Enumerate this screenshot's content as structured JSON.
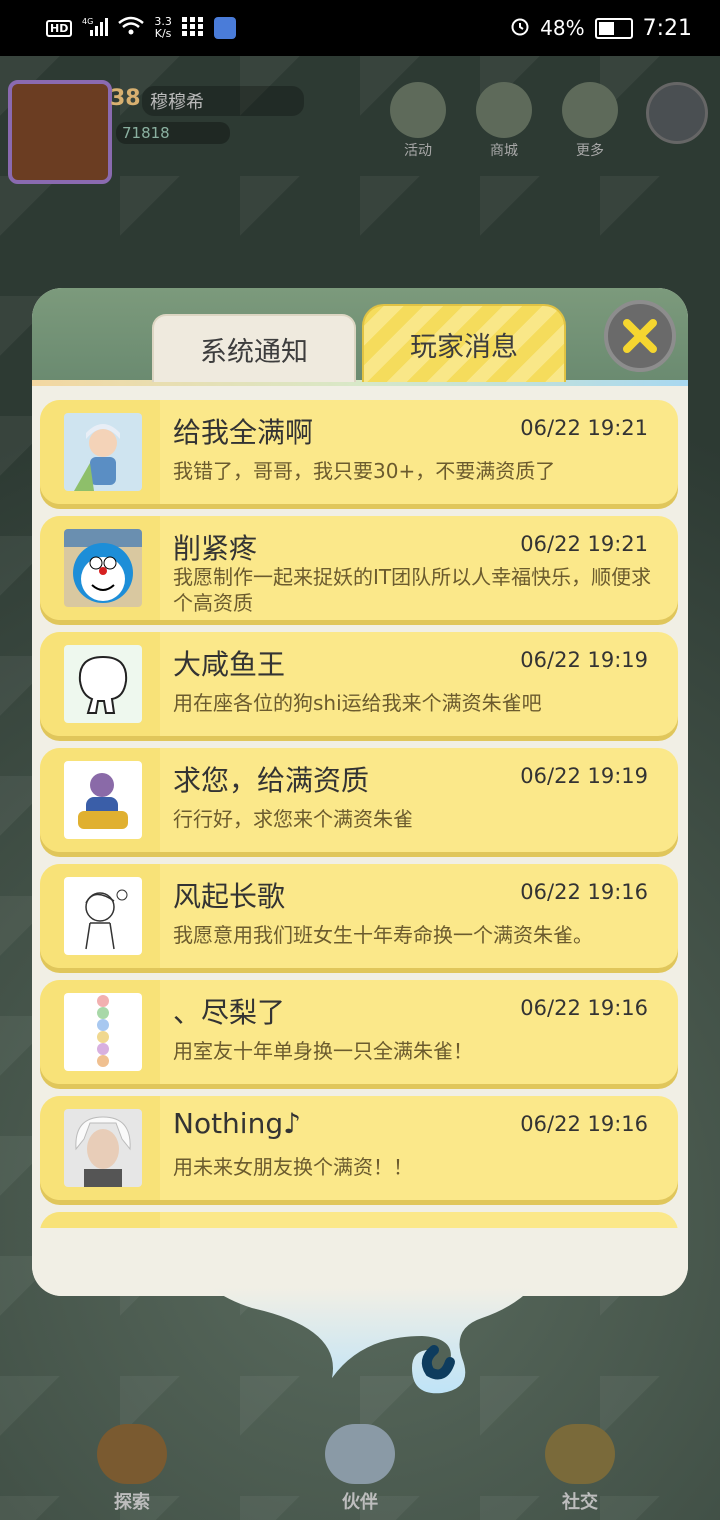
{
  "status_bar": {
    "hd": "HD",
    "net_type": "4G",
    "speed_value": "3.3",
    "speed_unit": "K/s",
    "battery": "48%",
    "time": "7:21"
  },
  "hud": {
    "level": "38",
    "player_name": "穆穆希",
    "coins": "71818",
    "buttons": [
      "活动",
      "商城",
      "更多"
    ]
  },
  "bottom_nav": [
    "探索",
    "伙伴",
    "社交"
  ],
  "tabs": {
    "system": "系统通知",
    "player": "玩家消息",
    "active": "player"
  },
  "messages": [
    {
      "name": "给我全满啊",
      "time": "06/22 19:21",
      "text": "我错了，哥哥，我只要30+，不要满资质了",
      "avatar": "anime-girl-avatar"
    },
    {
      "name": "削紧疼",
      "time": "06/22 19:21",
      "text": "我愿制作一起来捉妖的IT团队所以人幸福快乐，顺便求个高资质",
      "avatar": "doraemon-avatar"
    },
    {
      "name": "大咸鱼王",
      "time": "06/22 19:19",
      "text": "用在座各位的狗shi运给我来个满资朱雀吧",
      "avatar": "doodle-blob-avatar"
    },
    {
      "name": "求您，给满资质",
      "time": "06/22 19:19",
      "text": "行行好，求您来个满资朱雀",
      "avatar": "cartoon-villain-avatar"
    },
    {
      "name": "风起长歌",
      "time": "06/22 19:16",
      "text": "我愿意用我们班女生十年寿命换一个满资朱雀。",
      "avatar": "sketch-boy-avatar"
    },
    {
      "name": "、尽梨了",
      "time": "06/22 19:16",
      "text": "用室友十年单身换一只全满朱雀！",
      "avatar": "stacked-figures-avatar"
    },
    {
      "name": "Nothing♪",
      "time": "06/22 19:16",
      "text": "用未来女朋友换个满资！！",
      "avatar": "white-hair-portrait-avatar"
    }
  ],
  "colors": {
    "card": "#fbe88a",
    "card_shadow": "#e0c65b",
    "dialog_bg": "#f1efe5",
    "close_x": "#f5d630"
  }
}
